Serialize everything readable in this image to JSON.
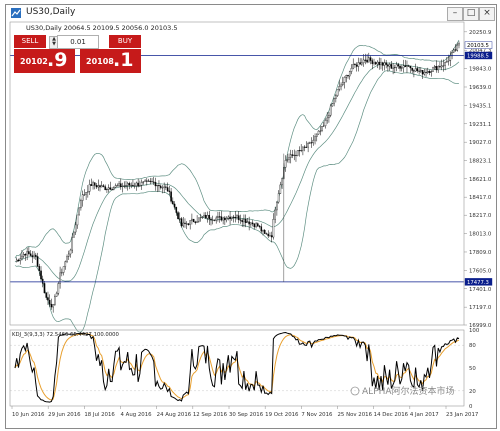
{
  "window": {
    "title": "US30,Daily",
    "ohlc": "US30,Daily  20064.5 20109.5 20056.0 20103.5"
  },
  "trade_panel": {
    "sell_label": "SELL",
    "buy_label": "BUY",
    "volume": "0.01",
    "sell_price_small": "20102",
    "sell_price_big": ".9",
    "buy_price_small": "20108",
    "buy_price_big": ".1"
  },
  "price_axis": {
    "ticks": [
      "20250.9",
      "20047.3",
      "19843.0",
      "19639.0",
      "19435.1",
      "19231.1",
      "19027.0",
      "18823.1",
      "18621.0",
      "18417.0",
      "18217.0",
      "18013.0",
      "17809.0",
      "17605.0",
      "17401.0",
      "17197.0",
      "16999.0"
    ],
    "current_price_label": "20103.5",
    "line1_label": "19988.5",
    "line2_label": "17477.3"
  },
  "indicator": {
    "label": "KDJ_3(9,3,3) 72.5466 65.4427 100.0000",
    "ticks": [
      "100",
      "80",
      "50",
      "20",
      "0"
    ]
  },
  "time_axis": {
    "labels": [
      "10 Jun 2016",
      "29 Jun 2016",
      "18 Jul 2016",
      "4 Aug 2016",
      "24 Aug 2016",
      "12 Sep 2016",
      "30 Sep 2016",
      "19 Oct 2016",
      "7 Nov 2016",
      "25 Nov 2016",
      "14 Dec 2016",
      "4 Jan 2017",
      "23 Jan 2017"
    ]
  },
  "watermark": "ALPHA阿尔法资本市场",
  "colors": {
    "sell_red": "#c61a1a",
    "candle": "#000000",
    "bollinger": "#5f8f83",
    "kdj_k": "#000000",
    "kdj_d": "#e8a030",
    "price_label_bg": "#0a1e8c"
  }
}
